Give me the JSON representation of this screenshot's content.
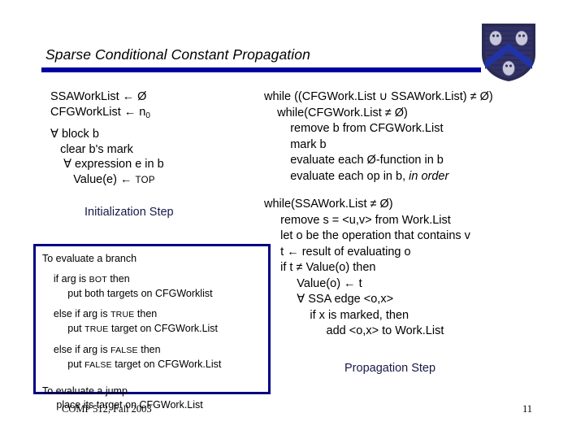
{
  "slide": {
    "title": "Sparse Conditional Constant Propagation",
    "accent_color": "#0000A0",
    "box_border_color": "#000080",
    "step_label_color": "#181848"
  },
  "logo": {
    "name": "rice-university-shield",
    "shield_dark": "#2a2a55",
    "shield_blue": "#2034a8",
    "owl_color": "#c8c8dc"
  },
  "initialization": {
    "lines": [
      "SSAWorkList ← Ø",
      "CFGWorkList ← n",
      "∀ block b",
      "   clear b's mark",
      "    ∀ expression e in b",
      "       Value(e) ← ",
      "TOP"
    ],
    "subscript_zero": "0",
    "step_label": "Initialization Step"
  },
  "branch_box": {
    "lines": [
      "To evaluate a branch",
      "    if arg is ",
      "BOT",
      " then",
      "         put both targets on CFGWorklist",
      "    else if arg is ",
      "TRUE",
      " then",
      "         put TRUE target on CFGWork.List",
      "    else if arg is ",
      "FALSE",
      " then",
      "         put FALSE target on CFGWork.List",
      "To evaluate a jump",
      "     place its target on CFGWork.List"
    ],
    "l1": "To evaluate a branch",
    "l2a": "    if arg is ",
    "l2b": "BOT",
    "l2c": " then",
    "l3": "         put both targets on CFGWorklist",
    "l4a": "    else if arg is ",
    "l4b": "TRUE",
    "l4c": " then",
    "l5a": "         put ",
    "l5b": "TRUE",
    "l5c": " target on CFGWork.List",
    "l6a": "    else if arg is ",
    "l6b": "FALSE",
    "l6c": " then",
    "l7a": "         put ",
    "l7b": "FALSE",
    "l7c": " target on CFGWork.List",
    "l8": "To evaluate a jump",
    "l9": "     place its target on CFGWork.List"
  },
  "propagation": {
    "cfg_lines": [
      "while ((CFGWork.List ∪ SSAWork.List) ≠ Ø)",
      "    while(CFGWork.List ≠ Ø)",
      "        remove b from CFGWork.List",
      "        mark b",
      "        evaluate each Ø-function in b",
      "        evaluate each op in b, "
    ],
    "in_order_italic": "in order",
    "ssa_lines": [
      "while(SSAWork.List ≠ Ø)",
      "     remove s = <u,v> from Work.List",
      "     let o be the operation that contains v",
      "     t ← result of evaluating o",
      "     if t ≠ Value(o) then",
      "          Value(o) ← t",
      "          ∀ SSA edge <o,x>",
      "              if x is marked, then",
      "                   add <o,x> to Work.List"
    ],
    "step_label": "Propagation Step"
  },
  "footer": {
    "course": "COMP 512, Fall 2003",
    "page_number": "11"
  }
}
